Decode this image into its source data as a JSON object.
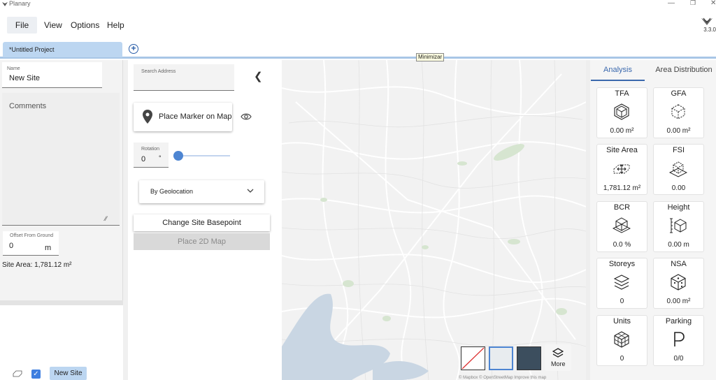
{
  "app": {
    "title": "Planary",
    "version": "3.3.0"
  },
  "menu": {
    "items": [
      "File",
      "View",
      "Options",
      "Help"
    ]
  },
  "tabs": {
    "project": "*Untitled Project"
  },
  "tooltip": "Minimizar",
  "left_panel": {
    "name_label": "Name",
    "name_value": "New Site",
    "comments_label": "Comments",
    "offset_label": "Offset From Ground",
    "offset_value": "0",
    "offset_unit": "m",
    "site_area_text": "Site Area: 1,781.12 m²",
    "layer": {
      "name": "New Site",
      "checked": true
    }
  },
  "mid_panel": {
    "search_label": "Search Address",
    "marker_button": "Place Marker on Map",
    "rotation_label": "Rotation",
    "rotation_value": "0",
    "rotation_unit": "°",
    "geo_select": "By Geolocation",
    "basepoint_button": "Change Site Basepoint",
    "place2d_button": "Place 2D Map"
  },
  "map": {
    "more_label": "More",
    "attribution": "© Mapbox © OpenStreetMap Improve this map"
  },
  "right_panel": {
    "tabs": [
      "Analysis",
      "Area Distribution"
    ],
    "cards": [
      {
        "title": "TFA",
        "value": "0.00 m²",
        "icon": "cube-icon"
      },
      {
        "title": "GFA",
        "value": "0.00 m²",
        "icon": "dashed-cube-icon"
      },
      {
        "title": "Site Area",
        "value": "1,781.12 m²",
        "icon": "site-area-icon"
      },
      {
        "title": "FSI",
        "value": "0.00",
        "icon": "fsi-cube-icon"
      },
      {
        "title": "BCR",
        "value": "0.0 %",
        "icon": "bcr-cube-icon"
      },
      {
        "title": "Height",
        "value": "0.00 m",
        "icon": "height-cube-icon"
      },
      {
        "title": "Storeys",
        "value": "0",
        "icon": "layers-icon"
      },
      {
        "title": "NSA",
        "value": "0.00 m²",
        "icon": "dice-icon"
      },
      {
        "title": "Units",
        "value": "0",
        "icon": "units-cube-icon"
      },
      {
        "title": "Parking",
        "value": "0/0",
        "icon": "parking-icon"
      }
    ]
  },
  "colors": {
    "accent": "#3a68ad",
    "tab_bg": "#bcd6f1",
    "map_bg": "#f2f2f2",
    "water": "#c9d6e3",
    "park": "#d6e5d0"
  }
}
